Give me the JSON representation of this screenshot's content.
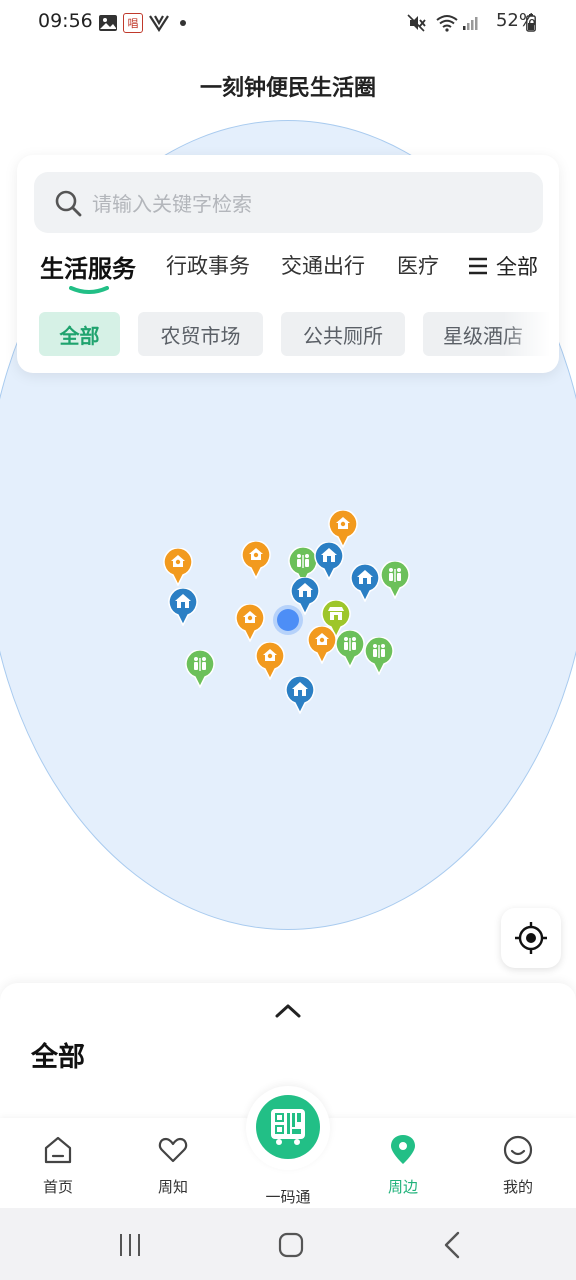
{
  "status_bar": {
    "time": "09:56",
    "battery": "52%",
    "icons": [
      "image-icon",
      "notification-app-icon",
      "v-app-icon",
      "dot-icon",
      "mute-icon",
      "wifi-icon",
      "signal-icon",
      "battery-icon"
    ],
    "notification_badge": "唱"
  },
  "header": {
    "title": "一刻钟便民生活圈"
  },
  "search": {
    "placeholder": "请输入关键字检索",
    "value": ""
  },
  "category_tabs": {
    "items": [
      "生活服务",
      "行政事务",
      "交通出行",
      "医疗"
    ],
    "active": "生活服务",
    "all_label": "全部"
  },
  "filter_chips": {
    "items": [
      "全部",
      "农贸市场",
      "公共厕所",
      "星级酒店"
    ],
    "active": "全部"
  },
  "map": {
    "pin_types": [
      "orange-service-pin",
      "blue-home-pin",
      "green-toilet-pin",
      "lime-market-pin"
    ]
  },
  "bottom_sheet": {
    "title": "全部"
  },
  "bottom_nav": {
    "items": [
      {
        "label": "首页",
        "icon": "home-icon"
      },
      {
        "label": "周知",
        "icon": "heart-icon"
      },
      {
        "label": "一码通",
        "icon": "qr-bus-icon"
      },
      {
        "label": "周边",
        "icon": "location-pin-icon",
        "active": true
      },
      {
        "label": "我的",
        "icon": "smile-icon"
      }
    ]
  },
  "colors": {
    "accent": "#22bf86",
    "map_fill": "#e4effc",
    "pin_orange": "#f29a1e",
    "pin_blue": "#2b7fc4",
    "pin_green": "#6cc05a",
    "pin_lime": "#9ec62a"
  }
}
